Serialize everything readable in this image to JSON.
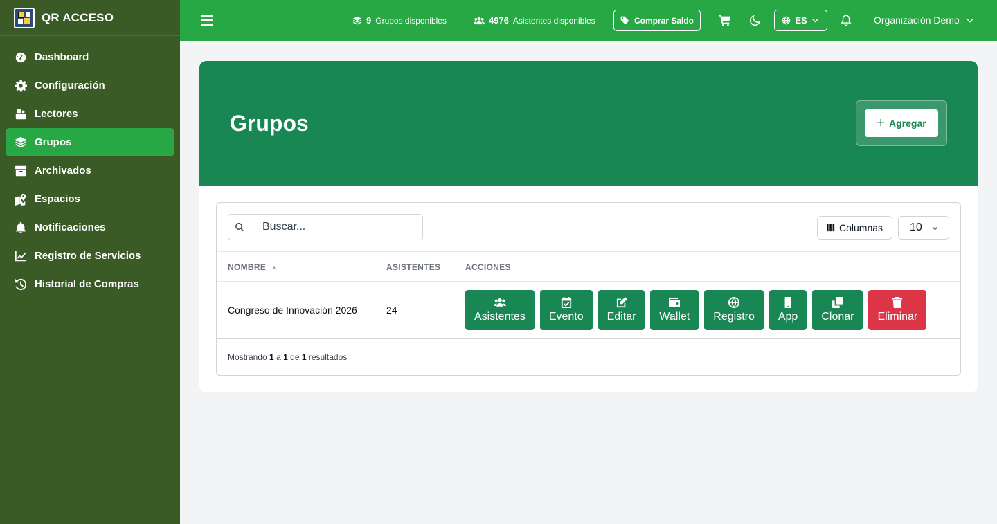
{
  "brand": {
    "name": "QR ACCESO"
  },
  "sidebar": {
    "items": [
      {
        "label": "Dashboard",
        "icon": "gauge-icon"
      },
      {
        "label": "Configuración",
        "icon": "gear-icon"
      },
      {
        "label": "Lectores",
        "icon": "reader-icon"
      },
      {
        "label": "Grupos",
        "icon": "layers-icon",
        "active": true
      },
      {
        "label": "Archivados",
        "icon": "archive-icon"
      },
      {
        "label": "Espacios",
        "icon": "map-pin-icon"
      },
      {
        "label": "Notificaciones",
        "icon": "bell-icon"
      },
      {
        "label": "Registro de Servicios",
        "icon": "chart-line-icon"
      },
      {
        "label": "Historial de Compras",
        "icon": "history-icon"
      }
    ]
  },
  "topbar": {
    "groups_count": "9",
    "groups_label": "Grupos disponibles",
    "attendees_count": "4976",
    "attendees_label": "Asistentes disponibles",
    "buy_label": "Comprar Saldo",
    "language": "ES",
    "organization": "Organización Demo"
  },
  "page": {
    "title": "Grupos",
    "add_label": "Agregar"
  },
  "table": {
    "search_placeholder": "Buscar...",
    "columns_label": "Columnas",
    "per_page": "10",
    "headers": {
      "name": "NOMBRE",
      "attendees": "ASISTENTES",
      "actions": "ACCIONES"
    },
    "rows": [
      {
        "name": "Congreso de Innovación 2026",
        "attendees": "24"
      }
    ],
    "actions": [
      {
        "label": "Asistentes",
        "icon": "users-icon"
      },
      {
        "label": "Evento",
        "icon": "calendar-check-icon"
      },
      {
        "label": "Editar",
        "icon": "edit-icon"
      },
      {
        "label": "Wallet",
        "icon": "wallet-icon"
      },
      {
        "label": "Registro",
        "icon": "globe-icon"
      },
      {
        "label": "App",
        "icon": "mobile-icon"
      },
      {
        "label": "Clonar",
        "icon": "clone-icon"
      },
      {
        "label": "Eliminar",
        "icon": "trash-icon",
        "danger": true
      }
    ],
    "footer": {
      "prefix": "Mostrando",
      "from": "1",
      "sep1": "a",
      "to": "1",
      "sep2": "de",
      "total": "1",
      "suffix": "resultados"
    }
  },
  "colors": {
    "sidebar": "#3a5a26",
    "topbar": "#28a745",
    "hero": "#198754",
    "danger": "#dc3545"
  }
}
